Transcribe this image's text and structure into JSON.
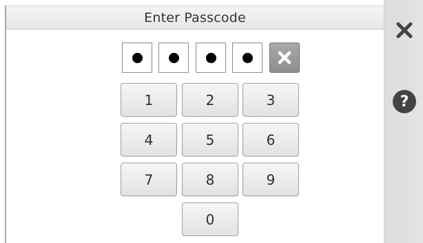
{
  "header": {
    "title": "Enter Passcode"
  },
  "passcode": {
    "filled_digits": 4,
    "total_digits": 4,
    "clear_icon": "x-icon"
  },
  "keypad": {
    "keys": [
      "1",
      "2",
      "3",
      "4",
      "5",
      "6",
      "7",
      "8",
      "9",
      "0"
    ]
  },
  "sidebar": {
    "close_icon": "close-icon",
    "help_label": "?"
  },
  "colors": {
    "header_bg": "#ececec",
    "clear_button_bg": "#9a9a9a",
    "key_bg": "#ececec",
    "help_button_bg": "#444444",
    "sidebar_bg": "#e0e0e0"
  }
}
